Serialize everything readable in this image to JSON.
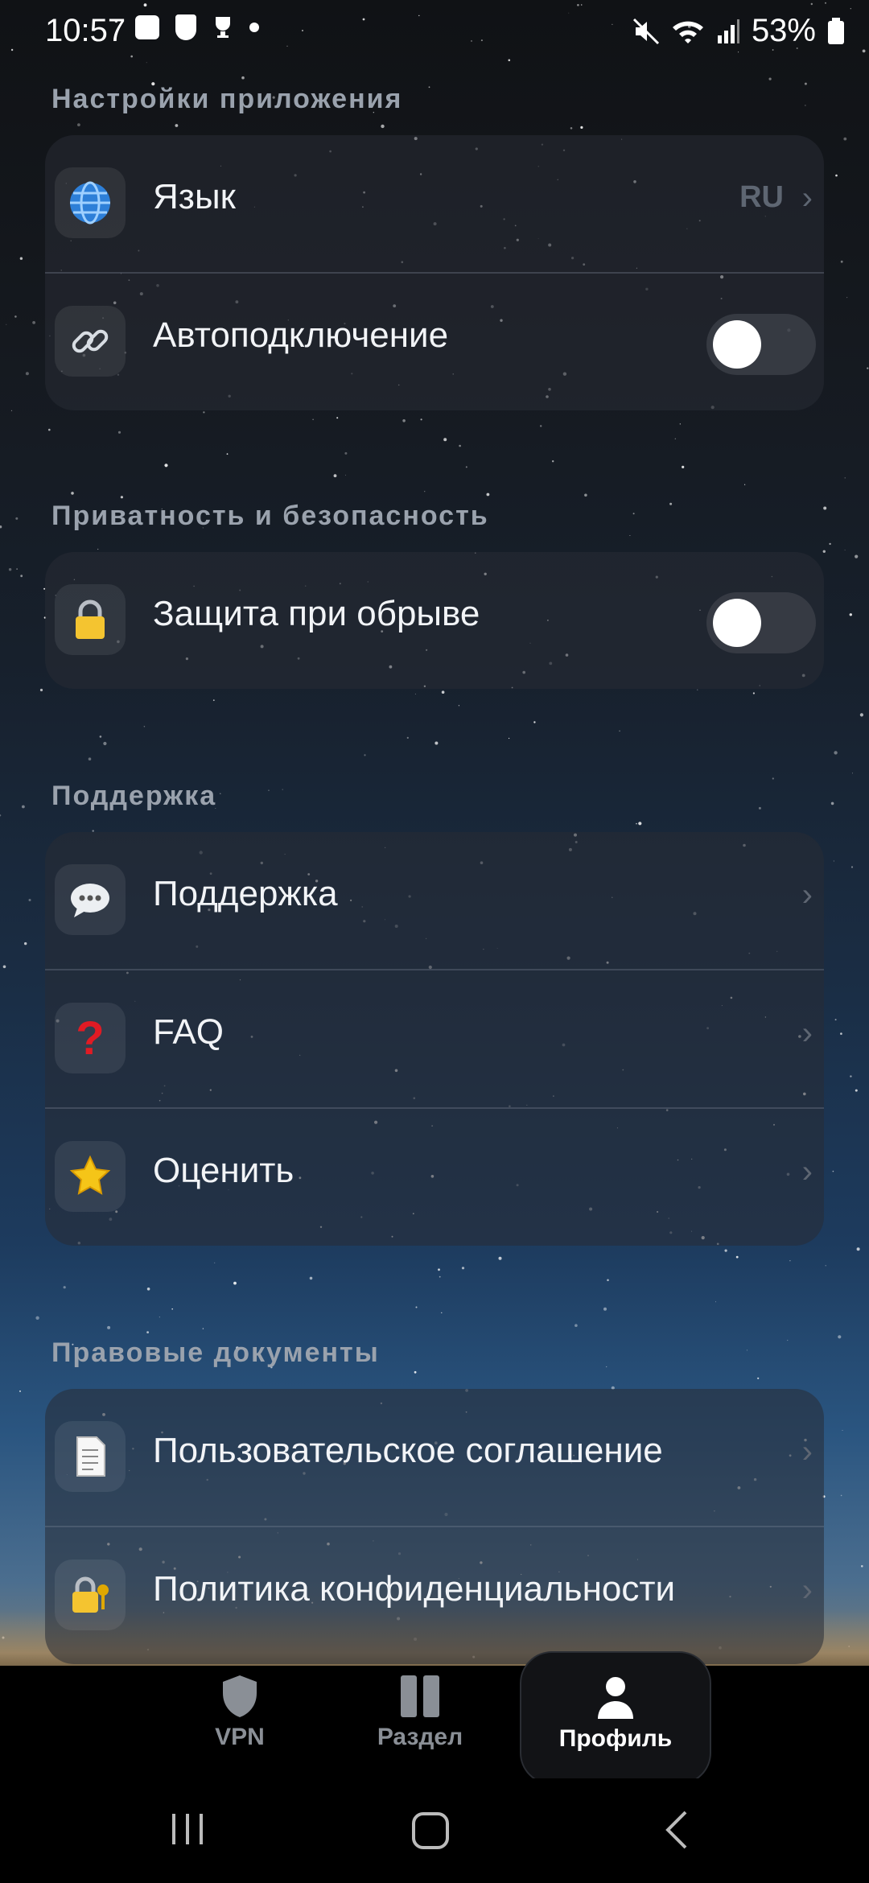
{
  "status_bar": {
    "time": "10:57",
    "battery": "53%"
  },
  "sections": {
    "app_settings": {
      "title": "Настройки приложения",
      "language": {
        "label": "Язык",
        "value": "RU"
      },
      "autoconnect": {
        "label": "Автоподключение",
        "enabled": false
      }
    },
    "privacy": {
      "title": "Приватность и безопасность",
      "kill_switch": {
        "label": "Защита при обрыве",
        "enabled": false
      }
    },
    "support": {
      "title": "Поддержка",
      "items": [
        {
          "label": "Поддержка",
          "icon": "speech-bubble-icon"
        },
        {
          "label": "FAQ",
          "icon": "question-mark-icon"
        },
        {
          "label": "Оценить",
          "icon": "star-icon"
        }
      ]
    },
    "legal": {
      "title": "Правовые документы",
      "items": [
        {
          "label": "Пользовательское соглашение",
          "icon": "document-icon"
        },
        {
          "label": "Политика конфиденциальности",
          "icon": "lock-key-icon"
        }
      ]
    }
  },
  "bottom_nav": {
    "items": [
      {
        "label": "VPN",
        "icon": "shield-icon"
      },
      {
        "label": "Раздел",
        "icon": "pause-icon"
      },
      {
        "label": "Профиль",
        "icon": "person-icon",
        "active": true
      }
    ]
  }
}
